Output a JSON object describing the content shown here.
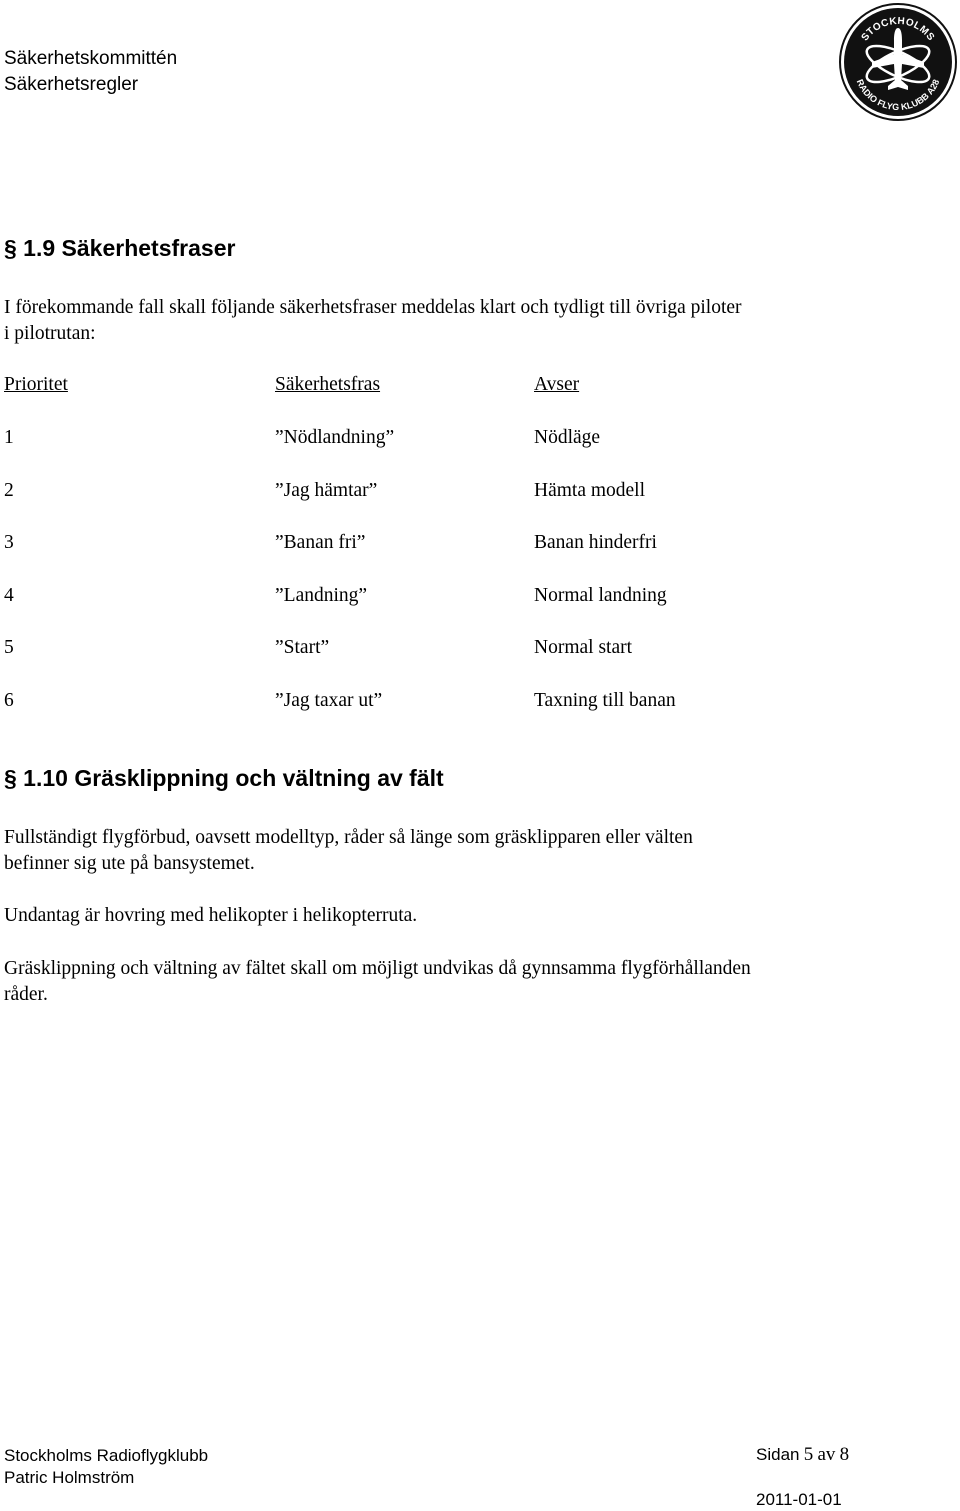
{
  "header": {
    "line1": "Säkerhetskommittén",
    "line2": "Säkerhetsregler",
    "logo": {
      "top_text": "STOCKHOLMS",
      "bottom_text": "RADIO FLYG KLUBB A28",
      "icon": "airplane-atom-logo-icon"
    }
  },
  "section1": {
    "heading": "§ 1.9 Säkerhetsfraser",
    "intro_line1": "I förekommande fall skall följande säkerhetsfraser meddelas klart och tydligt till övriga piloter",
    "intro_line2": "i pilotrutan:",
    "table": {
      "headers": [
        "Prioritet",
        "Säkerhetsfras",
        "Avser"
      ],
      "rows": [
        [
          "1",
          "”Nödlandning”",
          "Nödläge"
        ],
        [
          "2",
          "”Jag hämtar”",
          "Hämta modell"
        ],
        [
          "3",
          "”Banan fri”",
          "Banan hinderfri"
        ],
        [
          "4",
          "”Landning”",
          "Normal landning"
        ],
        [
          "5",
          "”Start”",
          "Normal start"
        ],
        [
          "6",
          "”Jag taxar ut”",
          "Taxning till banan"
        ]
      ]
    }
  },
  "section2": {
    "heading": "§ 1.10 Gräsklippning och vältning av fält",
    "para1_line1": "Fullständigt flygförbud, oavsett modelltyp, råder så länge som gräsklipparen eller välten",
    "para1_line2": "befinner sig ute på bansystemet.",
    "para2": "Undantag är hovring med helikopter i helikopterruta.",
    "para3_line1": "Gräsklippning och vältning av fältet skall om möjligt undvikas då gynnsamma flygförhållanden",
    "para3_line2": "råder."
  },
  "footer": {
    "org": "Stockholms Radioflygklubb",
    "author": "Patric Holmström",
    "page_prefix": "Sidan",
    "page_current": "5",
    "page_sep": "av",
    "page_total": "8",
    "date": "2011-01-01"
  }
}
